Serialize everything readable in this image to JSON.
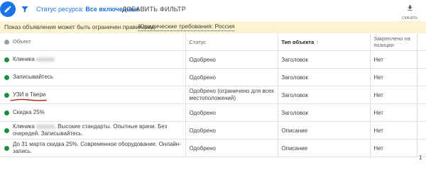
{
  "toolbar": {
    "filter_prefix": "Статус ресурса:",
    "filter_value": "Все включенные",
    "add_filter_label": "ДОБАВИТЬ ФИЛЬТР",
    "download_label": "СКАЧАТЬ"
  },
  "notice": {
    "text": "Показ объявления может быть ограничен правилами:",
    "link": "Юридические требования: Россия"
  },
  "table": {
    "headers": {
      "object": "Объект",
      "status": "Статус",
      "type": "Тип объекта",
      "pinned": "Закреплено на позиции"
    },
    "rows": [
      {
        "object": "Клиника",
        "status": "Одобрено",
        "type": "Заголовок",
        "pinned": "Нет"
      },
      {
        "object": "Записывайтесь",
        "status": "Одобрено",
        "type": "Заголовок",
        "pinned": "Нет"
      },
      {
        "object": "УЗИ в Твери",
        "status": "Одобрено (ограничено для всех местоположений)",
        "type": "Заголовок",
        "pinned": "Нет"
      },
      {
        "object": "Скидка 25%",
        "status": "Одобрено",
        "type": "Заголовок",
        "pinned": "Нет"
      },
      {
        "object_prefix": "Клиника",
        "object": ". Высокие стандарты. Опытные врачи. Без очередей. Записывайтесь.",
        "status": "Одобрено",
        "type": "Описание",
        "pinned": "Нет"
      },
      {
        "object": "До 31 марта скидка 25%. Современное оборудование. Онлайн-запись.",
        "status": "Одобрено",
        "type": "Описание",
        "pinned": "Нет"
      }
    ]
  },
  "pager": {
    "page": "1"
  },
  "colors": {
    "accent": "#1a73e8",
    "status_ok": "#1e8e3e",
    "warning_text": "#c5221f",
    "notice_bg": "#fdf3d0"
  },
  "icons": {
    "fab": "pencil-icon",
    "filter": "filter-icon",
    "download": "download-icon",
    "sort": "arrow-up-icon"
  }
}
